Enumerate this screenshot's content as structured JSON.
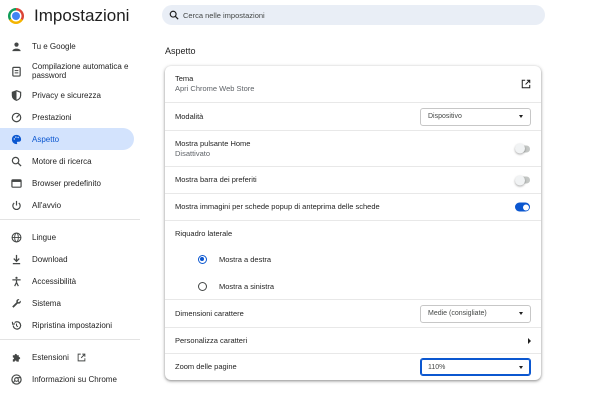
{
  "header": {
    "app_title": "Impostazioni",
    "search_placeholder": "Cerca nelle impostazioni"
  },
  "sidebar": {
    "items": [
      {
        "label": "Tu e Google",
        "icon": "person-icon"
      },
      {
        "label": "Compilazione automatica e password",
        "icon": "clipboard-icon"
      },
      {
        "label": "Privacy e sicurezza",
        "icon": "shield-icon"
      },
      {
        "label": "Prestazioni",
        "icon": "speedometer-icon"
      },
      {
        "label": "Aspetto",
        "icon": "palette-icon",
        "active": true
      },
      {
        "label": "Motore di ricerca",
        "icon": "search-icon"
      },
      {
        "label": "Browser predefinito",
        "icon": "browser-window-icon"
      },
      {
        "label": "All'avvio",
        "icon": "power-icon"
      },
      {
        "label": "Lingue",
        "icon": "globe-icon"
      },
      {
        "label": "Download",
        "icon": "download-icon"
      },
      {
        "label": "Accessibilità",
        "icon": "accessibility-icon"
      },
      {
        "label": "Sistema",
        "icon": "wrench-icon"
      },
      {
        "label": "Ripristina impostazioni",
        "icon": "restore-icon"
      },
      {
        "label": "Estensioni",
        "icon": "puzzle-icon"
      },
      {
        "label": "Informazioni su Chrome",
        "icon": "chrome-icon"
      }
    ]
  },
  "main": {
    "section_title": "Aspetto",
    "theme": {
      "title": "Tema",
      "subtitle": "Apri Chrome Web Store"
    },
    "mode": {
      "label": "Modalità",
      "value": "Dispositivo"
    },
    "home_button": {
      "title": "Mostra pulsante Home",
      "subtitle": "Disattivato",
      "enabled": false
    },
    "bookmarks_bar": {
      "label": "Mostra barra dei preferiti",
      "enabled": false
    },
    "tab_previews": {
      "label": "Mostra immagini per schede popup di anteprima delle schede",
      "enabled": true
    },
    "side_panel": {
      "label": "Riquadro laterale",
      "options": [
        {
          "label": "Mostra a destra",
          "selected": true
        },
        {
          "label": "Mostra a sinistra",
          "selected": false
        }
      ]
    },
    "font_size": {
      "label": "Dimensioni carattere",
      "value": "Medie (consigliate)"
    },
    "customize_fonts": {
      "label": "Personalizza caratteri"
    },
    "page_zoom": {
      "label": "Zoom delle pagine",
      "value": "110%"
    }
  },
  "colors": {
    "accent": "#0b57d0",
    "active_nav_bg": "#d3e3fd",
    "search_bg": "#e9eef6"
  }
}
